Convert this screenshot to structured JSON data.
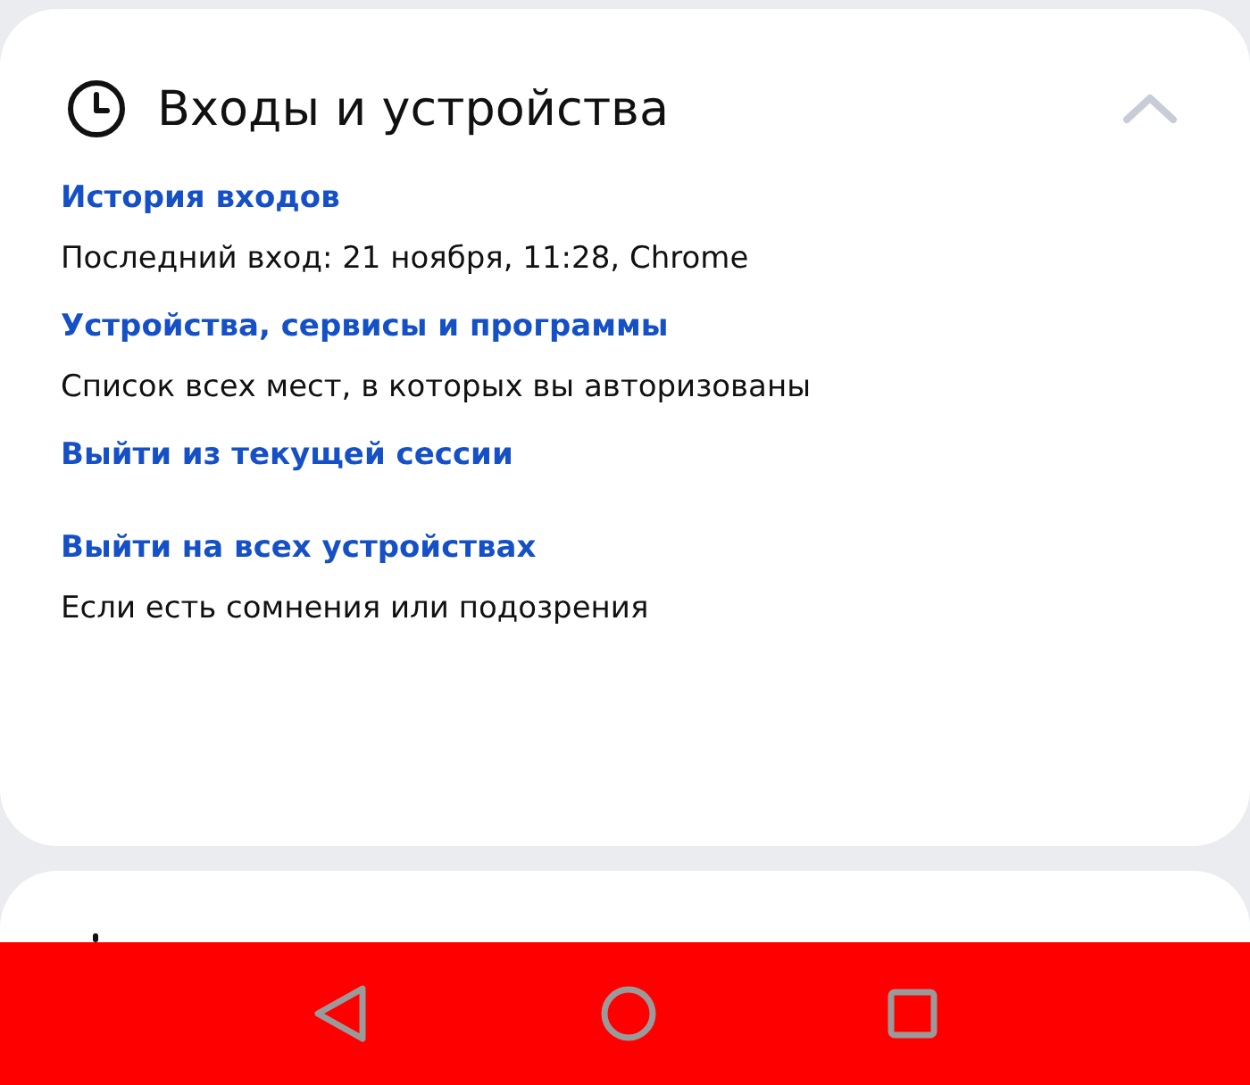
{
  "section": {
    "title": "Входы и устройства",
    "expanded": true,
    "items": [
      {
        "link": "История входов",
        "description": "Последний вход: 21 ноября, 11:28, Chrome"
      },
      {
        "link": "Устройства, сервисы и программы",
        "description": "Список всех мест, в которых вы авторизованы"
      },
      {
        "link": "Выйти из текущей сессии"
      },
      {
        "link": "Выйти на всех устройствах",
        "description": "Если есть сомнения или подозрения"
      }
    ]
  }
}
